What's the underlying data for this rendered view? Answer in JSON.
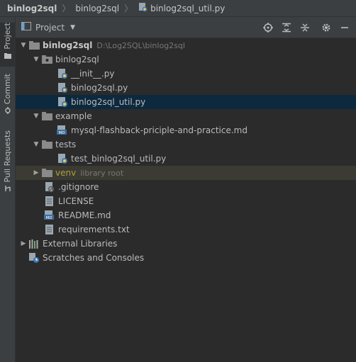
{
  "breadcrumb": {
    "project": "binlog2sql",
    "package": "binlog2sql",
    "file": "binlog2sql_util.py"
  },
  "tool_strip": {
    "project_tab": "Project",
    "commit_tab": "Commit",
    "pull_requests_tab": "Pull Requests"
  },
  "panel": {
    "title": "Project"
  },
  "tree": {
    "root": {
      "label": "binlog2sql",
      "path": "D:\\Log2SQL\\binlog2sql"
    },
    "pkg": {
      "label": "binlog2sql"
    },
    "pkg_files": [
      "__init__.py",
      "binlog2sql.py",
      "binlog2sql_util.py"
    ],
    "example": {
      "label": "example"
    },
    "example_files": [
      "mysql-flashback-priciple-and-practice.md"
    ],
    "tests": {
      "label": "tests"
    },
    "tests_files": [
      "test_binlog2sql_util.py"
    ],
    "venv": {
      "label": "venv",
      "hint": "library root"
    },
    "root_files": [
      ".gitignore",
      "LICENSE",
      "README.md",
      "requirements.txt"
    ],
    "external_libraries": "External Libraries",
    "scratches": "Scratches and Consoles"
  },
  "colors": {
    "selected_row": "#0d293e",
    "excluded_row": "#3b3a33",
    "folder": "#8a8a8a",
    "venv_text": "#b0a040"
  }
}
